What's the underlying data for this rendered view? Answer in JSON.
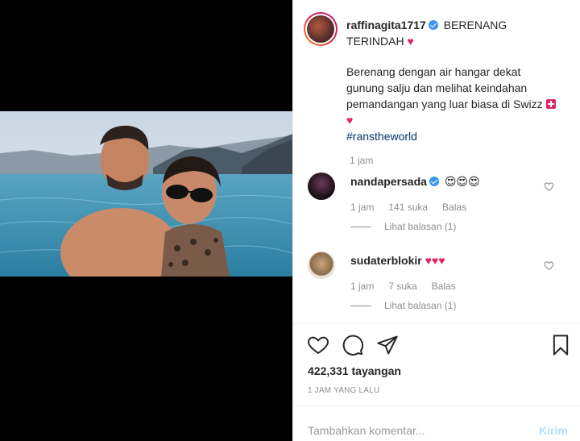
{
  "post": {
    "username": "raffinagita1717",
    "caption_title": "BERENANG TERINDAH",
    "caption_title_emoji": "♥",
    "caption_body": "Berenang dengan air hangar dekat gunung salju dan melihat keindahan pemandangan yang luar biasa di Swizz",
    "caption_body_emoji": "♥",
    "hashtag": "#ranstheworld",
    "caption_time": "1 jam"
  },
  "comments": [
    {
      "username": "nandapersada",
      "text": "😍😍😍",
      "time": "1 jam",
      "likes": "141 suka",
      "reply": "Balas",
      "view_replies": "Lihat balasan (1)"
    },
    {
      "username": "sudaterblokir",
      "text": "♥♥♥",
      "time": "1 jam",
      "likes": "7 suka",
      "reply": "Balas",
      "view_replies": "Lihat balasan (1)"
    }
  ],
  "stats": {
    "views": "422,331 tayangan",
    "posted_ago": "1 JAM YANG LALU"
  },
  "comment_box": {
    "placeholder": "Tambahkan komentar...",
    "send_label": "Kirim"
  },
  "colors": {
    "verified": "#3897f0",
    "heart": "#e0245e",
    "hashtag": "#003569",
    "muted": "#8e8e8e",
    "send_disabled": "#b2dffc"
  },
  "icons": {
    "like": "heart-outline-icon",
    "comment": "speech-bubble-icon",
    "share": "paper-plane-icon",
    "save": "bookmark-icon",
    "verified": "verified-badge-icon"
  }
}
